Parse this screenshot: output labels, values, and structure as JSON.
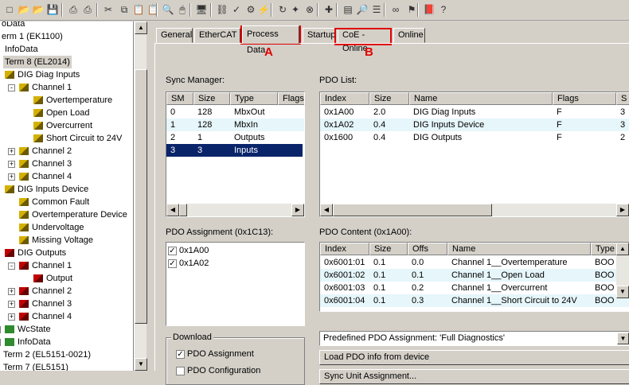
{
  "toolbar": {
    "icons": [
      "new-file-icon",
      "open-folder-icon",
      "open-icon",
      "save-icon",
      "print-icon",
      "print-preview-icon",
      "cut-icon",
      "copy-icon",
      "paste-icon",
      "paste-with-links-icon",
      "find-icon",
      "mouse-icon",
      "screen-icon",
      "network-icon",
      "check-icon",
      "build-icon",
      "activate-icon",
      "restart-icon",
      "wand-icon",
      "stop-icon",
      "add-icon",
      "document-icon",
      "zoom-icon",
      "list-icon",
      "goggles-icon",
      "tree-icon",
      "help-book-icon",
      "about-icon"
    ]
  },
  "tree": {
    "items": [
      {
        "label": "oData",
        "icon": "none",
        "x": 2,
        "expander": ""
      },
      {
        "label": "erm 1 (EK1100)",
        "icon": "none",
        "x": 2,
        "expander": ""
      },
      {
        "label": "InfoData",
        "icon": "none",
        "x": 6,
        "expander": ""
      },
      {
        "label": "Term 8 (EL2014)",
        "icon": "none",
        "x": 4,
        "expander": ""
      },
      {
        "label": "DIG Diag Inputs",
        "icon": "yellow",
        "x": 6,
        "expander": ""
      },
      {
        "label": "Channel 1",
        "icon": "yellow",
        "x": 24,
        "expander": "-"
      },
      {
        "label": "Overtemperature",
        "icon": "yellow",
        "x": 42,
        "expander": ""
      },
      {
        "label": "Open Load",
        "icon": "yellow",
        "x": 42,
        "expander": ""
      },
      {
        "label": "Overcurrent",
        "icon": "yellow",
        "x": 42,
        "expander": ""
      },
      {
        "label": "Short Circuit to 24V",
        "icon": "yellow",
        "x": 42,
        "expander": ""
      },
      {
        "label": "Channel 2",
        "icon": "yellow",
        "x": 24,
        "expander": "+"
      },
      {
        "label": "Channel 3",
        "icon": "yellow",
        "x": 24,
        "expander": "+"
      },
      {
        "label": "Channel 4",
        "icon": "yellow",
        "x": 24,
        "expander": "+"
      },
      {
        "label": "DIG Inputs Device",
        "icon": "yellow",
        "x": 6,
        "expander": ""
      },
      {
        "label": "Common Fault",
        "icon": "yellow",
        "x": 24,
        "expander": ""
      },
      {
        "label": "Overtemperature Device",
        "icon": "yellow",
        "x": 24,
        "expander": ""
      },
      {
        "label": "Undervoltage",
        "icon": "yellow",
        "x": 24,
        "expander": ""
      },
      {
        "label": "Missing Voltage",
        "icon": "yellow",
        "x": 24,
        "expander": ""
      },
      {
        "label": "DIG Outputs",
        "icon": "red",
        "x": 6,
        "expander": ""
      },
      {
        "label": "Channel 1",
        "icon": "red",
        "x": 24,
        "expander": "-"
      },
      {
        "label": "Output",
        "icon": "red",
        "x": 42,
        "expander": ""
      },
      {
        "label": "Channel 2",
        "icon": "red",
        "x": 24,
        "expander": "+"
      },
      {
        "label": "Channel 3",
        "icon": "red",
        "x": 24,
        "expander": "+"
      },
      {
        "label": "Channel 4",
        "icon": "red",
        "x": 24,
        "expander": "+"
      },
      {
        "label": "WcState",
        "icon": "green",
        "x": 6,
        "expander": "+"
      },
      {
        "label": "InfoData",
        "icon": "green",
        "x": 6,
        "expander": "+"
      },
      {
        "label": "Term 2 (EL5151-0021)",
        "icon": "none",
        "x": 4,
        "expander": ""
      },
      {
        "label": "Term 7 (EL5151)",
        "icon": "none",
        "x": 4,
        "expander": ""
      }
    ]
  },
  "tabs": [
    "General",
    "EtherCAT",
    "Process Data",
    "Startup",
    "CoE - Online",
    "Online"
  ],
  "markers": {
    "a": "A",
    "b": "B"
  },
  "sync_manager": {
    "label": "Sync Manager:",
    "columns": [
      "SM",
      "Size",
      "Type",
      "Flags"
    ],
    "rows": [
      [
        "0",
        "128",
        "MbxOut",
        ""
      ],
      [
        "1",
        "128",
        "MbxIn",
        ""
      ],
      [
        "2",
        "1",
        "Outputs",
        ""
      ],
      [
        "3",
        "3",
        "Inputs",
        ""
      ]
    ]
  },
  "pdo_list": {
    "label": "PDO List:",
    "columns": [
      "Index",
      "Size",
      "Name",
      "Flags",
      "S"
    ],
    "rows": [
      [
        "0x1A00",
        "2.0",
        "DIG Diag Inputs",
        "F",
        "3"
      ],
      [
        "0x1A02",
        "0.4",
        "DIG Inputs Device",
        "F",
        "3"
      ],
      [
        "0x1600",
        "0.4",
        "DIG Outputs",
        "F",
        "2"
      ]
    ]
  },
  "pdo_assignment": {
    "label": "PDO Assignment (0x1C13):",
    "items": [
      "0x1A00",
      "0x1A02"
    ]
  },
  "pdo_content": {
    "label": "PDO Content (0x1A00):",
    "columns": [
      "Index",
      "Size",
      "Offs",
      "Name",
      "Type"
    ],
    "rows": [
      [
        "0x6001:01",
        "0.1",
        "0.0",
        "Channel 1__Overtemperature",
        "BOO"
      ],
      [
        "0x6001:02",
        "0.1",
        "0.1",
        "Channel 1__Open Load",
        "BOO"
      ],
      [
        "0x6001:03",
        "0.1",
        "0.2",
        "Channel 1__Overcurrent",
        "BOO"
      ],
      [
        "0x6001:04",
        "0.1",
        "0.3",
        "Channel 1__Short Circuit to 24V",
        "BOO"
      ]
    ]
  },
  "download": {
    "label": "Download",
    "pdo_assignment": "PDO Assignment",
    "pdo_configuration": "PDO Configuration"
  },
  "predefined": "Predefined PDO Assignment: 'Full Diagnostics'",
  "load_button": "Load PDO info from device",
  "sync_unit_button": "Sync Unit Assignment..."
}
